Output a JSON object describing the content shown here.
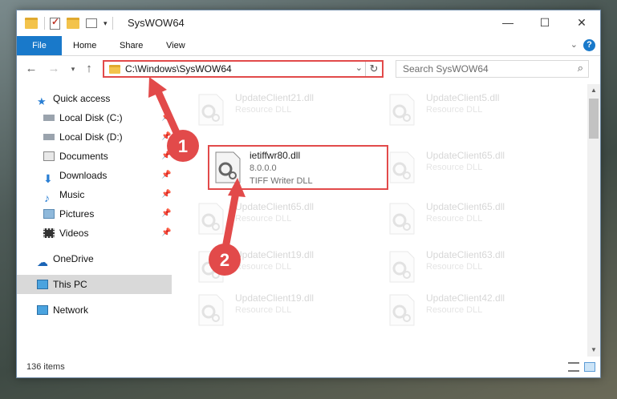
{
  "window": {
    "title": "SysWOW64",
    "controls": {
      "minimize": "—",
      "maximize": "☐",
      "close": "✕"
    }
  },
  "ribbon": {
    "tabs": [
      "File",
      "Home",
      "Share",
      "View"
    ],
    "help": "?"
  },
  "address_bar": {
    "path": "C:\\Windows\\SysWOW64"
  },
  "search": {
    "placeholder": "Search SysWOW64"
  },
  "nav_pane": {
    "items": [
      {
        "label": "Quick access",
        "icon": "star-icon"
      },
      {
        "label": "Local Disk (C:)",
        "icon": "drive-icon",
        "pinned": true
      },
      {
        "label": "Local Disk (D:)",
        "icon": "drive-icon",
        "pinned": true
      },
      {
        "label": "Documents",
        "icon": "documents-icon",
        "pinned": true
      },
      {
        "label": "Downloads",
        "icon": "download-icon",
        "pinned": true
      },
      {
        "label": "Music",
        "icon": "music-icon",
        "pinned": true
      },
      {
        "label": "Pictures",
        "icon": "pictures-icon",
        "pinned": true
      },
      {
        "label": "Videos",
        "icon": "videos-icon",
        "pinned": true
      },
      {
        "label": "OneDrive",
        "icon": "cloud-icon"
      },
      {
        "label": "This PC",
        "icon": "pc-icon",
        "selected": true
      },
      {
        "label": "Network",
        "icon": "network-icon"
      }
    ]
  },
  "files": {
    "column1": [
      {
        "name": "UpdateClient21.dll",
        "desc": "Resource DLL"
      },
      {
        "name": "ietiffwr80.dll",
        "version": "8.0.0.0",
        "desc": "TIFF Writer DLL",
        "highlighted": true
      },
      {
        "name": "UpdateClient65.dll",
        "desc": "Resource DLL"
      },
      {
        "name": "UpdateClient19.dll",
        "desc": "Resource DLL"
      },
      {
        "name": "UpdateClient19.dll",
        "desc": "Resource DLL"
      }
    ],
    "column2": [
      {
        "name": "UpdateClient5.dll",
        "desc": "Resource DLL"
      },
      {
        "name": "UpdateClient65.dll",
        "desc": "Resource DLL"
      },
      {
        "name": "UpdateClient65.dll",
        "desc": "Resource DLL"
      },
      {
        "name": "UpdateClient63.dll",
        "desc": "Resource DLL"
      },
      {
        "name": "UpdateClient42.dll",
        "desc": "Resource DLL"
      }
    ]
  },
  "status": {
    "item_count": "136 items"
  },
  "annotations": [
    {
      "number": "1"
    },
    {
      "number": "2"
    }
  ],
  "colors": {
    "accent": "#1979ca",
    "annotation_red": "#e24a4a"
  }
}
